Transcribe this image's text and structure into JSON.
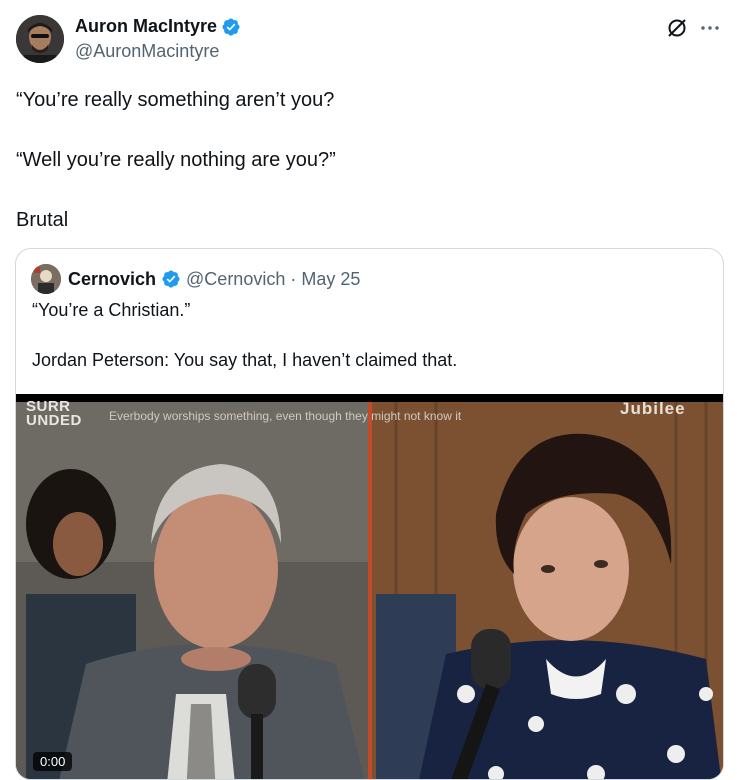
{
  "tweet": {
    "author_name": "Auron MacIntyre",
    "author_handle": "@AuronMacintyre",
    "lines": [
      "“You’re really something aren’t you?",
      "“Well you’re really nothing are you?”",
      "Brutal"
    ]
  },
  "quoted": {
    "author_name": "Cernovich",
    "author_handle": "@Cernovich",
    "separator": "·",
    "date": "May 25",
    "lines": [
      "“You’re a Christian.”",
      "Jordan Peterson: You say that, I haven’t claimed that."
    ],
    "video": {
      "caption_left": "SURR UNDED",
      "caption_left_line1": "SURR",
      "caption_left_line2": "UNDED",
      "caption_sub": "Everbody worships something, even though they might not know it",
      "caption_brand": "Jubilee",
      "timer": "0:00"
    }
  },
  "icons": {
    "verified": "verified-badge-icon",
    "grok": "grok-icon",
    "more": "more-options-icon"
  },
  "colors": {
    "verified_blue": "#1d9bf0",
    "secondary_text": "#536471",
    "border": "#cfd9de"
  }
}
